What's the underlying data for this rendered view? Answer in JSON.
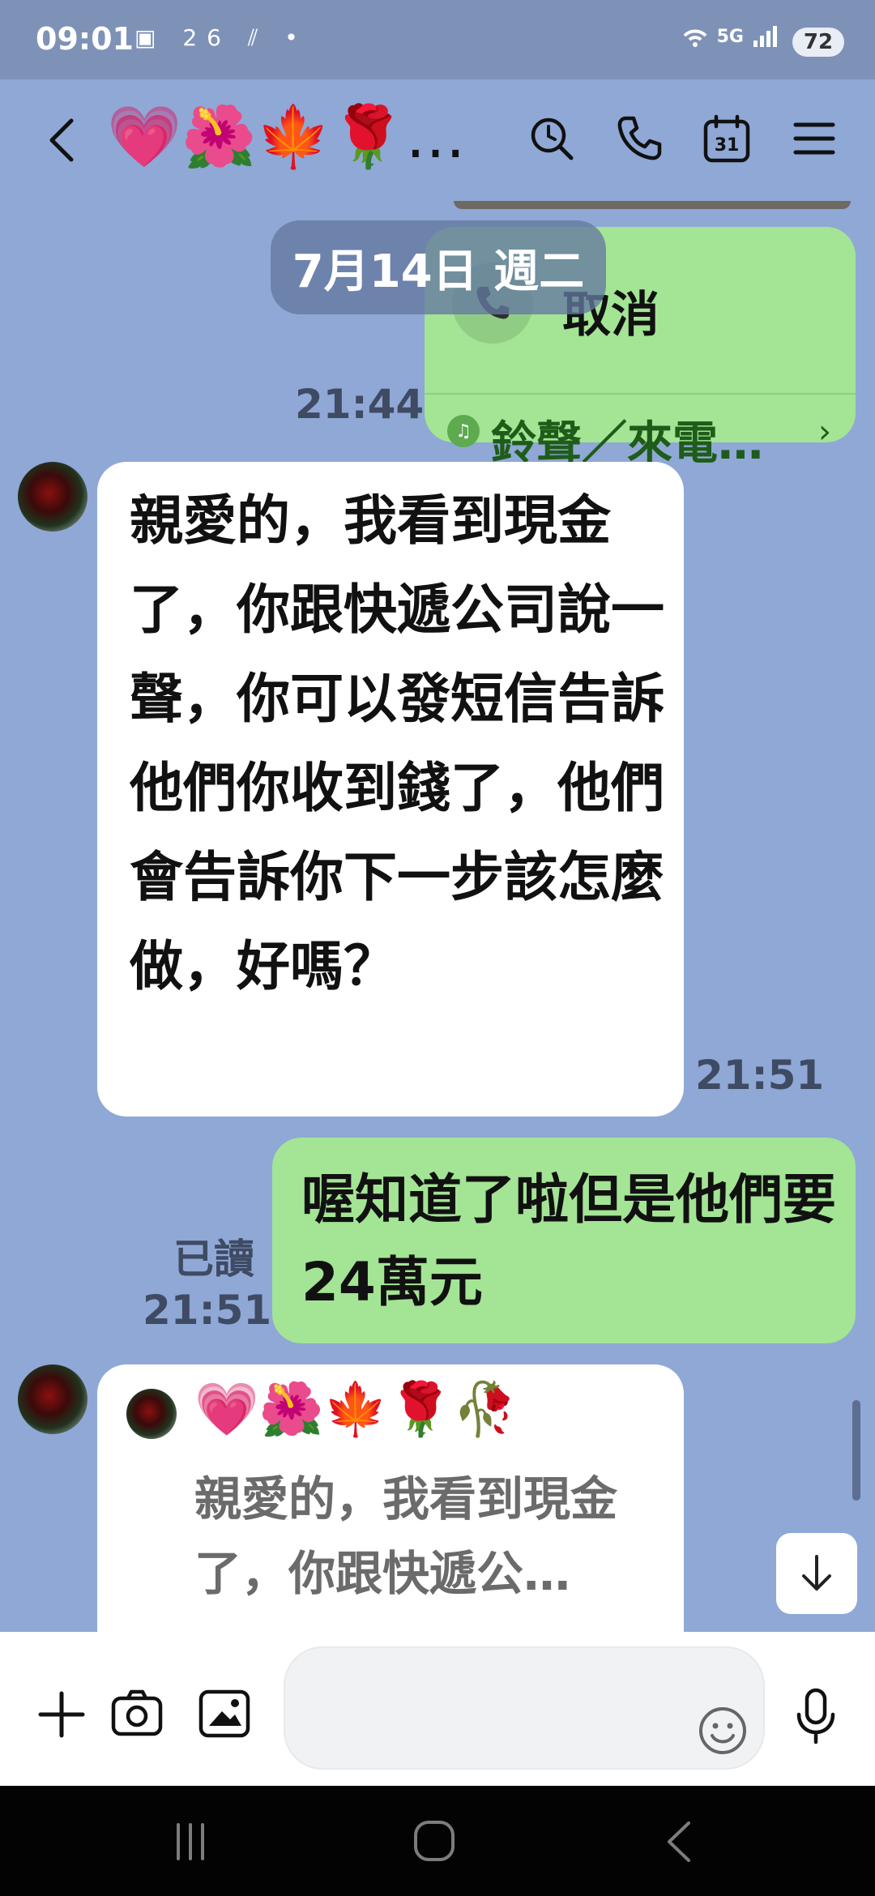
{
  "status_bar": {
    "time": "09:01",
    "left_icons": "▣ 26 ⫽ •",
    "network": "5G",
    "battery": "72"
  },
  "header": {
    "title": "💗🌺🍁🌹…"
  },
  "messages": {
    "date_separator": "7月14日 週二",
    "call": {
      "label": "取消",
      "ringtone_label": "鈴聲／來電…",
      "time": "21:44"
    },
    "msg1": {
      "text": "親愛的，我看到現金了，你跟快遞公司說一聲，你可以發短信告訴他們你收到錢了，他們會告訴你下一步該怎麼做，好嗎？",
      "time": "21:51"
    },
    "msg2": {
      "text": "喔知道了啦但是他們要24萬元",
      "read": "已讀",
      "time": "21:51"
    },
    "msg3": {
      "reply_title": "💗🌺🍁🌹🥀",
      "reply_text": "親愛的，我看到現金了，你跟快遞公…"
    }
  },
  "input": {
    "placeholder": ""
  },
  "colors": {
    "background": "#8fa8d6",
    "outgoing_bubble": "#a3e495",
    "incoming_bubble": "#ffffff",
    "status_bar": "#7e92b8"
  }
}
